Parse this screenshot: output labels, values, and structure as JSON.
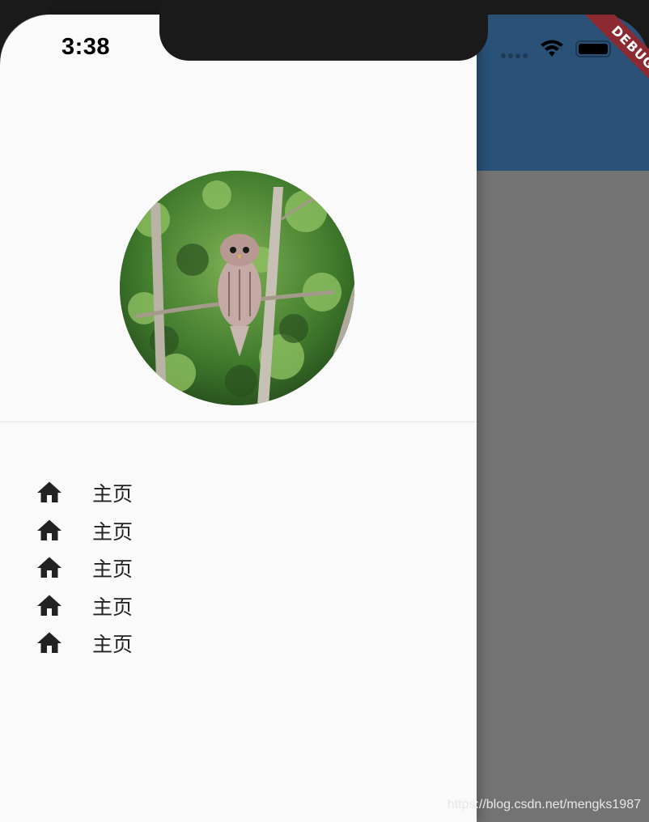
{
  "status_bar": {
    "time": "3:38"
  },
  "debug_banner": {
    "label": "DEBUG"
  },
  "drawer": {
    "avatar_icon": "owl-photo",
    "menu_items": [
      {
        "icon": "home-icon",
        "label": "主页"
      },
      {
        "icon": "home-icon",
        "label": "主页"
      },
      {
        "icon": "home-icon",
        "label": "主页"
      },
      {
        "icon": "home-icon",
        "label": "主页"
      },
      {
        "icon": "home-icon",
        "label": "主页"
      }
    ]
  },
  "watermark": "https://blog.csdn.net/mengks1987",
  "colors": {
    "app_bar": "#2a5177",
    "drawer_bg": "#fafafa",
    "scrim": "#737373",
    "debug": "#8b2a31"
  }
}
